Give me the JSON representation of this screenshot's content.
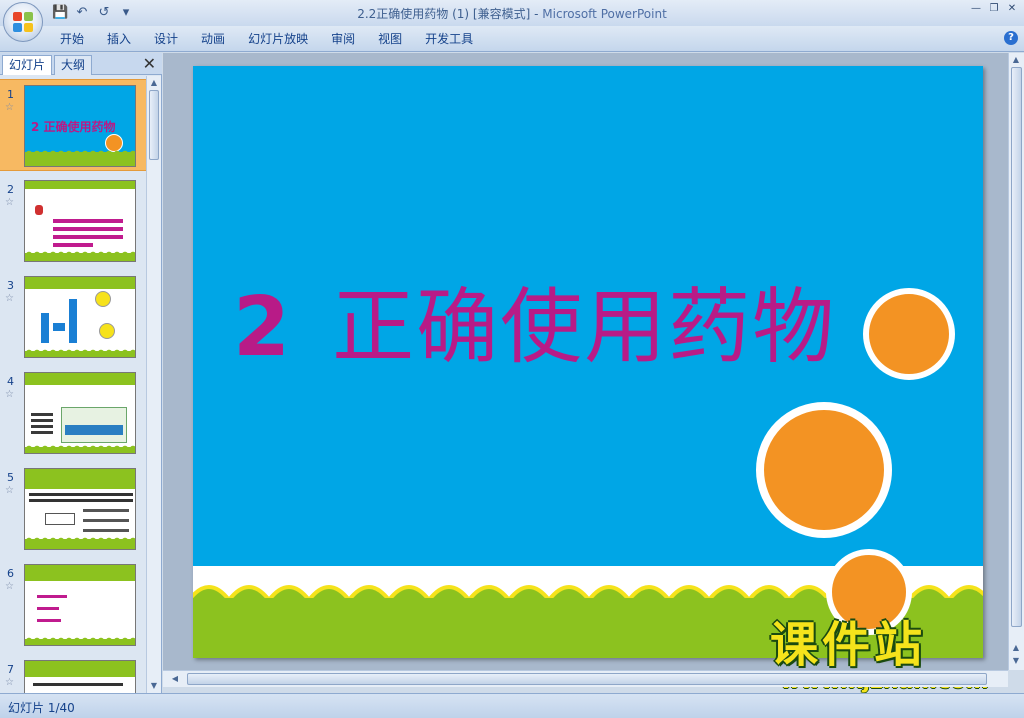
{
  "window": {
    "title": "2.2正确使用药物 (1) [兼容模式]",
    "app_name": "Microsoft PowerPoint"
  },
  "quick_access": [
    "save-icon",
    "undo-icon",
    "redo-icon",
    "customize-icon"
  ],
  "ribbon": {
    "tabs": [
      "开始",
      "插入",
      "设计",
      "动画",
      "幻灯片放映",
      "审阅",
      "视图",
      "开发工具"
    ]
  },
  "panel": {
    "tab_slides": "幻灯片",
    "tab_outline": "大纲",
    "slide_numbers": [
      "1",
      "2",
      "3",
      "4",
      "5",
      "6",
      "7"
    ],
    "thumb1_title": "2 正确使用药物"
  },
  "slide": {
    "number": "2",
    "title": "正确使用药物"
  },
  "watermark": {
    "cn": "课件站",
    "url": "www.kjzhan.com"
  },
  "status": {
    "slide_counter": "幻灯片 1/40"
  },
  "colors": {
    "slide_bg": "#00a6e6",
    "title": "#b81b87",
    "orange": "#f39323",
    "green": "#8cc21f",
    "selected_thumb": "#f7b962"
  }
}
